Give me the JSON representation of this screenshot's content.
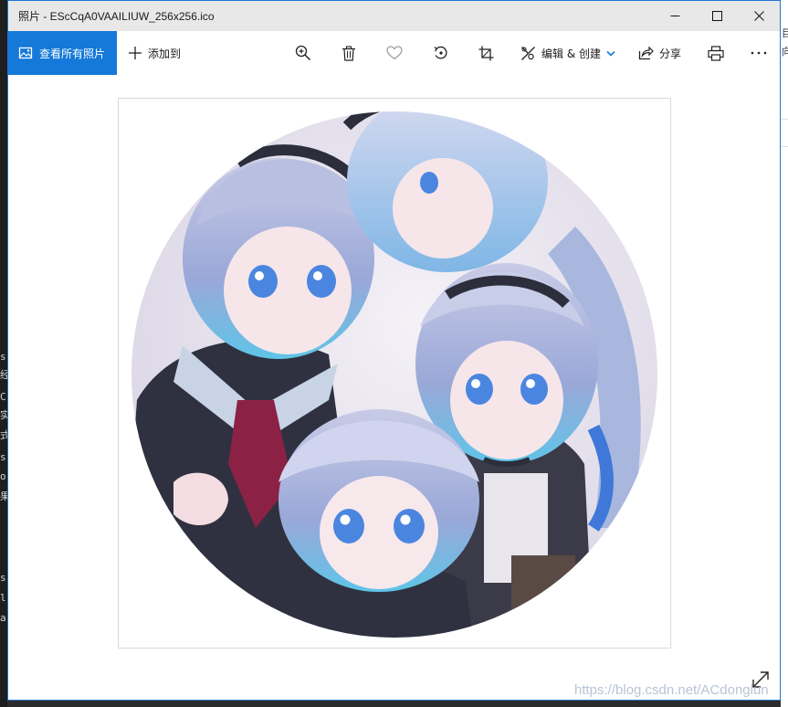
{
  "window": {
    "title": "照片 - EScCqA0VAAILIUW_256x256.ico",
    "controls": {
      "minimize_icon": "minimize-icon",
      "maximize_icon": "maximize-icon",
      "close_icon": "close-icon"
    }
  },
  "toolbar": {
    "view_all_label": "查看所有照片",
    "add_to_label": "添加到",
    "edit_create_label": "编辑 & 创建",
    "share_label": "分享",
    "accent_color": "#1479d8"
  },
  "background": {
    "left_glyphs": [
      "s",
      "经",
      "C",
      "实",
      "式",
      "s",
      "or",
      "果",
      "s",
      "l",
      "a"
    ],
    "right_glyphs": [
      "目",
      "向"
    ]
  },
  "watermark": "https://blog.csdn.net/ACdonglun"
}
